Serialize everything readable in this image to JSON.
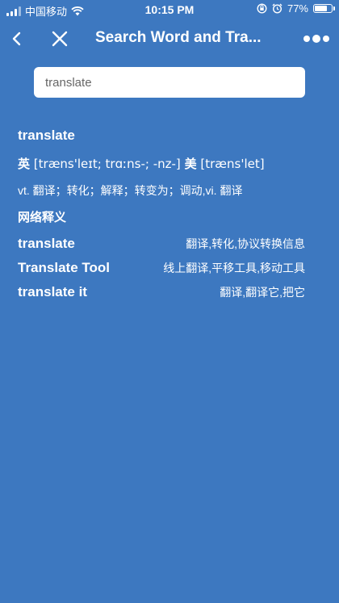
{
  "status_bar": {
    "carrier": "中国移动",
    "time": "10:15 PM",
    "battery_text": "77%",
    "battery_level": 0.77
  },
  "nav": {
    "title": "Search Word and Tra..."
  },
  "search": {
    "value": "translate"
  },
  "result": {
    "word": "translate",
    "phonetic_uk_tag": "英",
    "phonetic_uk": "[træns'leɪt; trɑːns-; -nz-]",
    "phonetic_us_tag": "美",
    "phonetic_us": "[træns'let]",
    "basic": "vt. 翻译；转化；解释；转变为；调动,vi. 翻译",
    "web_section_title": "网络释义",
    "web": [
      {
        "key": "translate",
        "value": "翻译,转化,协议转换信息"
      },
      {
        "key": "Translate Tool",
        "value": "线上翻译,平移工具,移动工具"
      },
      {
        "key": "translate it",
        "value": "翻译,翻译它,把它"
      }
    ]
  },
  "colors": {
    "background": "#3d78c0",
    "text": "#ffffff"
  },
  "icons": [
    "back-icon",
    "close-icon",
    "more-icon",
    "wifi-icon",
    "signal-icon",
    "lock-rotation-icon",
    "alarm-icon",
    "battery-icon"
  ]
}
